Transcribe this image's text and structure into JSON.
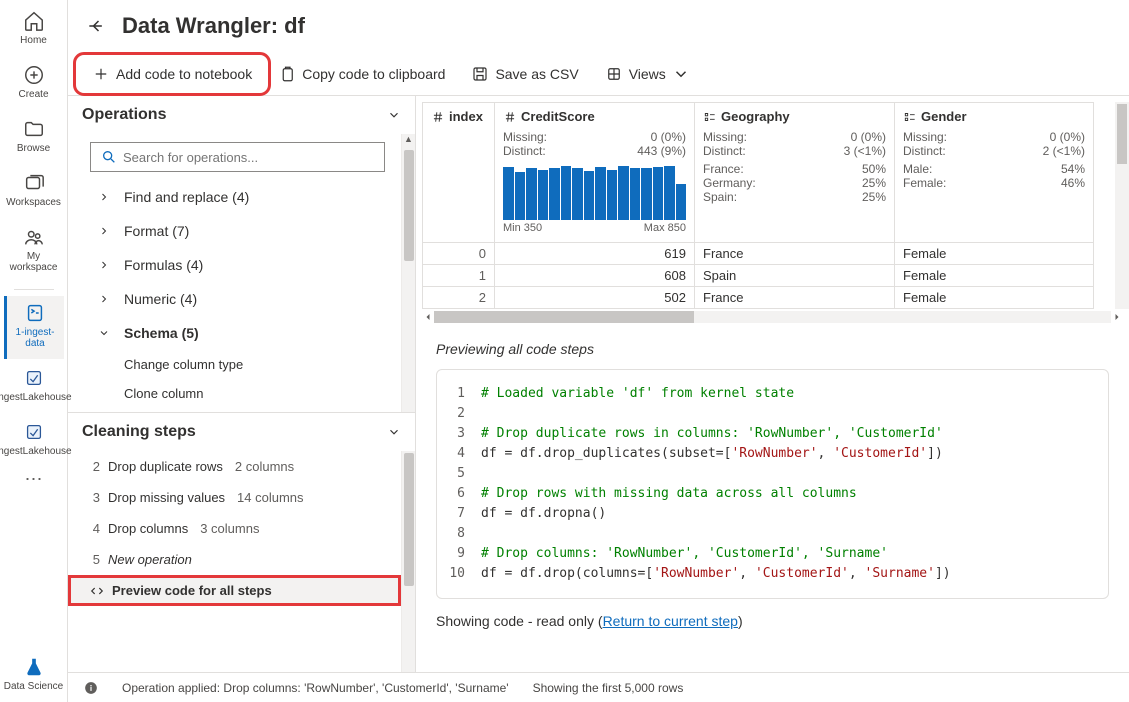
{
  "rail": {
    "home": "Home",
    "create": "Create",
    "browse": "Browse",
    "workspaces": "Workspaces",
    "myws": "My workspace",
    "ingest": "1-ingest-data",
    "lakeh1": "IngestLakehouse",
    "lakeh2": "IngestLakehouse",
    "ds": "Data Science"
  },
  "title": "Data Wrangler: df",
  "toolbar": {
    "add": "Add code to notebook",
    "copy": "Copy code to clipboard",
    "csv": "Save as CSV",
    "views": "Views"
  },
  "ops": {
    "header": "Operations",
    "search": "Search for operations...",
    "cats": [
      {
        "name": "Find and replace",
        "count": 4,
        "expanded": false
      },
      {
        "name": "Format",
        "count": 7,
        "expanded": false
      },
      {
        "name": "Formulas",
        "count": 4,
        "expanded": false
      },
      {
        "name": "Numeric",
        "count": 4,
        "expanded": false
      },
      {
        "name": "Schema",
        "count": 5,
        "expanded": true,
        "subs": [
          "Change column type",
          "Clone column"
        ]
      }
    ]
  },
  "steps": {
    "header": "Cleaning steps",
    "rows": [
      {
        "n": "2",
        "label": "Drop duplicate rows",
        "detail": "2 columns"
      },
      {
        "n": "3",
        "label": "Drop missing values",
        "detail": "14 columns"
      },
      {
        "n": "4",
        "label": "Drop columns",
        "detail": "3 columns"
      },
      {
        "n": "5",
        "label": "New operation",
        "italic": true
      }
    ],
    "preview": "Preview code for all steps"
  },
  "columns": [
    {
      "name": "index",
      "type": "hash",
      "idx": true
    },
    {
      "name": "CreditScore",
      "type": "hash",
      "missing": "0 (0%)",
      "distinct": "443 (9%)",
      "histo": [
        0.95,
        0.85,
        0.92,
        0.9,
        0.93,
        0.97,
        0.92,
        0.88,
        0.95,
        0.9,
        0.97,
        0.93,
        0.92,
        0.94,
        0.96,
        0.65
      ],
      "min": "Min 350",
      "max": "Max 850"
    },
    {
      "name": "Geography",
      "type": "cat",
      "missing": "0 (0%)",
      "distinct": "3 (<1%)",
      "cats": [
        [
          "France:",
          "50%"
        ],
        [
          "Germany:",
          "25%"
        ],
        [
          "Spain:",
          "25%"
        ]
      ]
    },
    {
      "name": "Gender",
      "type": "cat",
      "missing": "0 (0%)",
      "distinct": "2 (<1%)",
      "cats": [
        [
          "Male:",
          "54%"
        ],
        [
          "Female:",
          "46%"
        ]
      ]
    }
  ],
  "rows": [
    {
      "idx": "0",
      "credit": "619",
      "geo": "France",
      "gender": "Female"
    },
    {
      "idx": "1",
      "credit": "608",
      "geo": "Spain",
      "gender": "Female"
    },
    {
      "idx": "2",
      "credit": "502",
      "geo": "France",
      "gender": "Female"
    }
  ],
  "labels": {
    "missing": "Missing:",
    "distinct": "Distinct:"
  },
  "code": {
    "label": "Previewing all code steps",
    "readonly": "Showing code - read only",
    "returnlink": "Return to current step"
  },
  "status": {
    "applied": "Operation applied: Drop columns: 'RowNumber', 'CustomerId', 'Surname'",
    "showing": "Showing the first 5,000 rows"
  }
}
